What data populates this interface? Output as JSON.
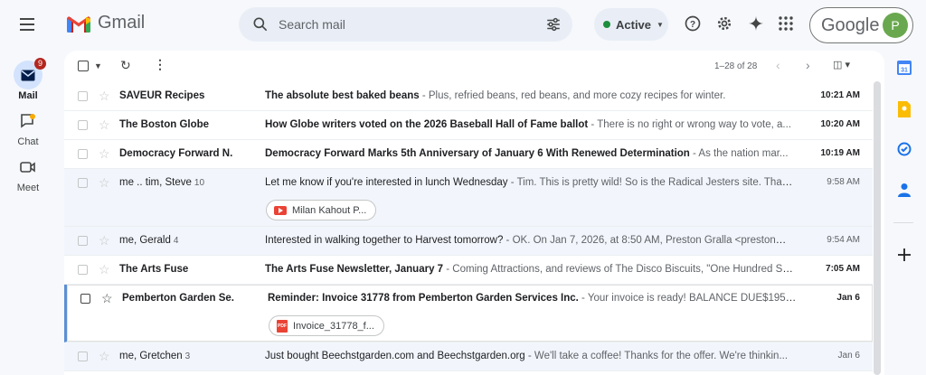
{
  "header": {
    "app_name": "Gmail",
    "search_placeholder": "Search mail",
    "status": "Active",
    "account_label": "Google",
    "avatar_initial": "P"
  },
  "left_rail": [
    {
      "label": "Mail",
      "badge": "9"
    },
    {
      "label": "Chat",
      "badge": ""
    },
    {
      "label": "Meet",
      "badge": ""
    }
  ],
  "toolbar": {
    "count": "1–28 of 28"
  },
  "emails": [
    {
      "sender": "SAVEUR Recipes",
      "count": "",
      "subject": "The absolute best baked beans",
      "snippet": " - Plus, refried beans, red beans, and more cozy recipes for winter.",
      "date": "10:21 AM",
      "unread": true,
      "attachment": ""
    },
    {
      "sender": "The Boston Globe",
      "count": "",
      "subject": "How Globe writers voted on the 2026 Baseball Hall of Fame ballot",
      "snippet": " - There is no right or wrong way to vote, a...",
      "date": "10:20 AM",
      "unread": true,
      "attachment": ""
    },
    {
      "sender": "Democracy Forward N.",
      "count": "",
      "subject": "Democracy Forward Marks 5th Anniversary of January 6 With Renewed Determination",
      "snippet": " - As the nation mar...",
      "date": "10:19 AM",
      "unread": true,
      "attachment": ""
    },
    {
      "sender": "me .. tim, Steve",
      "count": "10",
      "subject": "Let me know if you're interested in lunch Wednesday",
      "snippet": " - Tim. This is pretty wild! So is the Radical Jesters site. Than...",
      "date": "9:58 AM",
      "unread": false,
      "attachment": "Milan Kahout P..."
    },
    {
      "sender": "me, Gerald",
      "count": "4",
      "subject": "Interested in walking together to Harvest tomorrow?",
      "snippet": " - OK. On Jan 7, 2026, at 8:50 AM, Preston Gralla <preston@...",
      "date": "9:54 AM",
      "unread": false,
      "attachment": ""
    },
    {
      "sender": "The Arts Fuse",
      "count": "",
      "subject": "The Arts Fuse Newsletter, January 7",
      "snippet": " - Coming Attractions, and reviews of The Disco Biscuits, \"One Hundred St...",
      "date": "7:05 AM",
      "unread": true,
      "attachment": ""
    },
    {
      "sender": "Pemberton Garden Se.",
      "count": "",
      "subject": "Reminder: Invoice 31778 from Pemberton Garden Services Inc.",
      "snippet": " - Your invoice is ready! BALANCE DUE$195.0...",
      "date": "Jan 6",
      "unread": true,
      "attachment": "Invoice_31778_f..."
    },
    {
      "sender": "me, Gretchen",
      "count": "3",
      "subject": "Just bought Beechstgarden.com and Beechstgarden.org",
      "snippet": " - We'll take a coffee! Thanks for the offer. We're thinkin...",
      "date": "Jan 6",
      "unread": false,
      "attachment": ""
    }
  ],
  "colors": {
    "background": "#f6f8fc",
    "accent": "#0b57d0",
    "avatar": "#6aa84f",
    "badge": "#b3261e"
  }
}
